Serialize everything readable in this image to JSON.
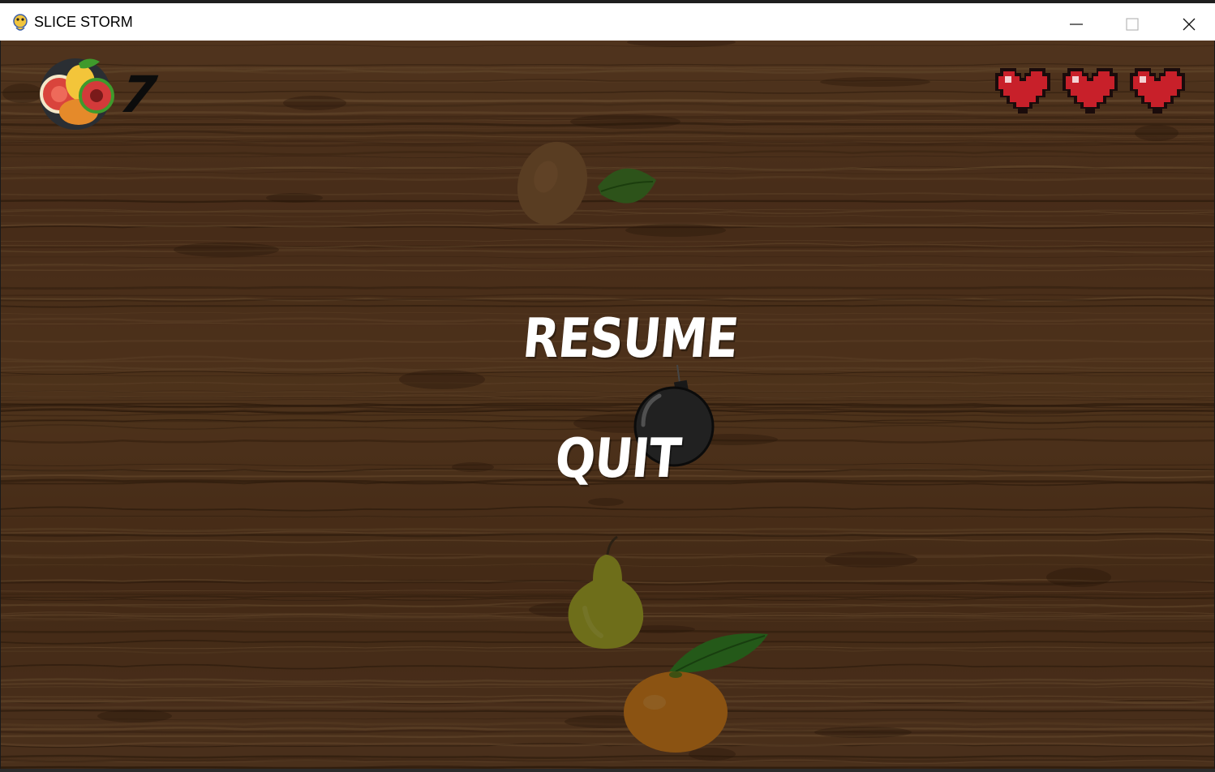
{
  "window": {
    "title": "SLICE STORM",
    "icon": "pygame-snake-icon",
    "controls": [
      "minimize-icon",
      "maximize-icon",
      "close-icon"
    ]
  },
  "hud": {
    "score": "7",
    "score_icon": "fruit-bowl-icon",
    "lives_total": 3,
    "lives_remaining": 3,
    "life_icon": "pixel-heart-icon"
  },
  "pause_menu": {
    "resume_label": "RESUME",
    "quit_label": "QUIT"
  },
  "scene_objects": [
    "kiwi",
    "leaf",
    "bomb",
    "pear",
    "orange"
  ],
  "colors": {
    "wood": "#7a5230",
    "overlay": "rgba(0,0,0,0.42)",
    "heart": "#c8202a",
    "menu_text": "#ffffff"
  }
}
